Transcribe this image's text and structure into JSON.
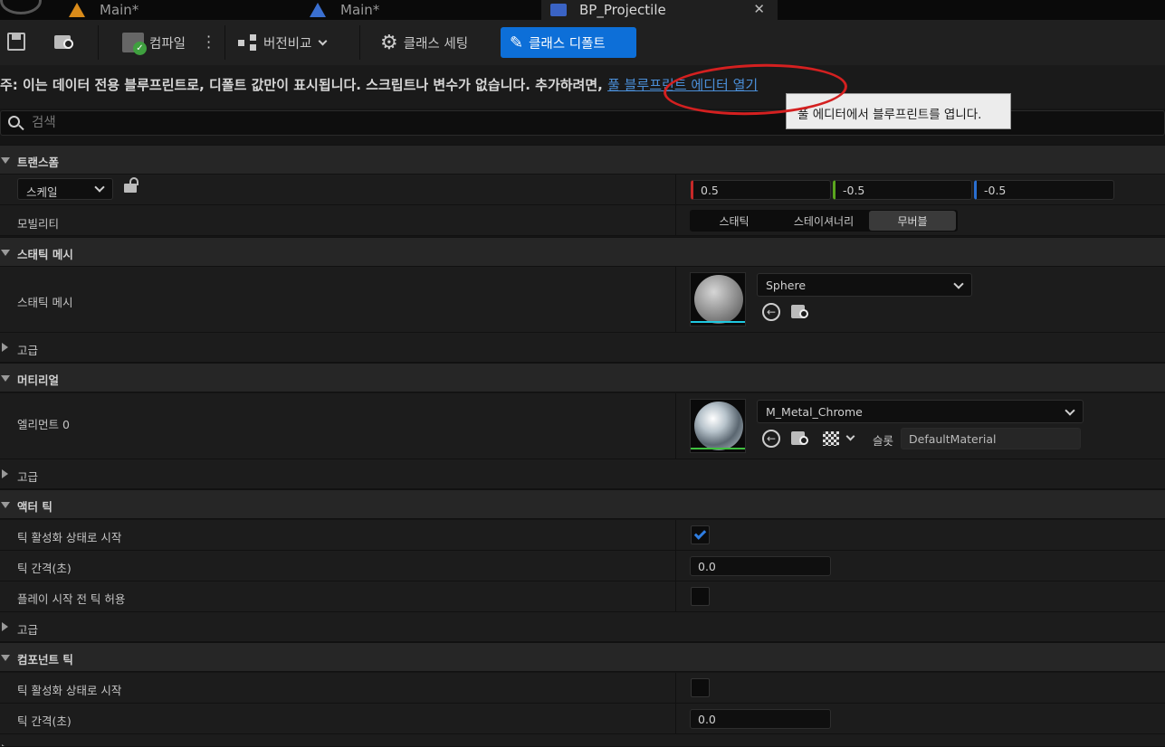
{
  "tabs": [
    {
      "label": "Main*"
    },
    {
      "label": "Main*"
    },
    {
      "label": "BP_Projectile"
    }
  ],
  "toolbar": {
    "compile_label": "컴파일",
    "diff_label": "버전비교",
    "class_settings_label": "클래스 세팅",
    "class_defaults_label": "클래스 디폴트"
  },
  "notice": {
    "text": "주: 이는 데이터 전용 블루프린트로, 디폴트 값만이 표시됩니다. 스크립트나 변수가 없습니다. 추가하려면, ",
    "link": "풀 블루프린트 에디터 열기"
  },
  "tooltip": "풀 에디터에서 블루프린트를 엽니다.",
  "search": {
    "placeholder": "검색"
  },
  "transform": {
    "header": "트랜스폼",
    "scale_label": "스케일",
    "scale": {
      "x": "0.5",
      "y": "-0.5",
      "z": "-0.5"
    },
    "mobility_label": "모빌리티",
    "mobility_options": [
      "스태틱",
      "스테이셔너리",
      "무버블"
    ],
    "mobility_selected": "무버블"
  },
  "static_mesh": {
    "header": "스태틱 메시",
    "label": "스태틱 메시",
    "value": "Sphere",
    "advanced": "고급"
  },
  "materials": {
    "header": "머티리얼",
    "element_label": "엘리먼트 0",
    "value": "M_Metal_Chrome",
    "slot_label": "슬롯",
    "slot_value": "DefaultMaterial",
    "advanced": "고급"
  },
  "actor_tick": {
    "header": "액터 틱",
    "start_enabled_label": "틱 활성화 상태로 시작",
    "start_enabled": true,
    "interval_label": "틱 간격(초)",
    "interval": "0.0",
    "before_begin_label": "플레이 시작 전 틱 허용",
    "before_begin": false,
    "advanced": "고급"
  },
  "component_tick": {
    "header": "컴포넌트 틱",
    "start_enabled_label": "틱 활성화 상태로 시작",
    "start_enabled": false,
    "interval_label": "틱 간격(초)",
    "interval": "0.0",
    "advanced": "고급"
  },
  "colors": {
    "accent": "#0d6fd8",
    "link": "#4b8fd8",
    "annotation": "#d42020",
    "x_axis": "#c62828",
    "y_axis": "#5aa61e",
    "z_axis": "#2a6fd0"
  }
}
